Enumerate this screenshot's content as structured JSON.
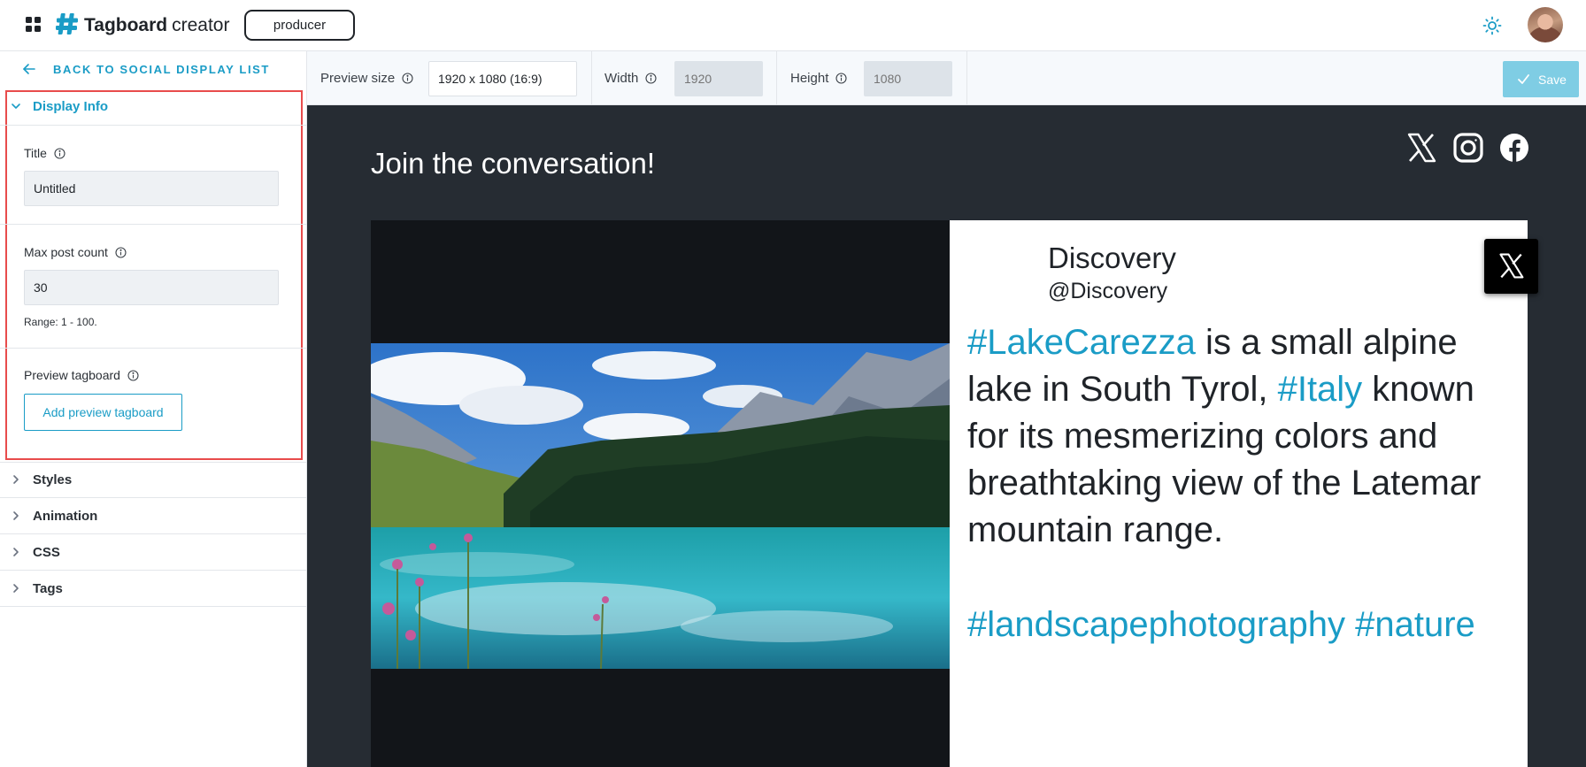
{
  "header": {
    "brand_bold": "Tagboard",
    "brand_light": "creator",
    "role": "producer"
  },
  "sidebar": {
    "back_label": "BACK TO SOCIAL DISPLAY LIST",
    "sections": [
      {
        "label": "Display Info",
        "expanded": true
      },
      {
        "label": "Styles",
        "expanded": false
      },
      {
        "label": "Animation",
        "expanded": false
      },
      {
        "label": "CSS",
        "expanded": false
      },
      {
        "label": "Tags",
        "expanded": false
      }
    ],
    "display_info": {
      "title_label": "Title",
      "title_value": "Untitled",
      "max_post_label": "Max post count",
      "max_post_value": "30",
      "range_hint": "Range: 1 - 100.",
      "preview_label": "Preview tagboard",
      "preview_button": "Add preview tagboard"
    }
  },
  "toolbar": {
    "preview_size_label": "Preview size",
    "preview_size_value": "1920 x 1080 (16:9)",
    "width_label": "Width",
    "width_value": "1920",
    "height_label": "Height",
    "height_value": "1080",
    "save_label": "Save"
  },
  "preview": {
    "headline": "Join the conversation!",
    "social_icons": [
      "x-icon",
      "instagram-icon",
      "facebook-icon"
    ],
    "post": {
      "author_name": "Discovery",
      "author_handle": "@Discovery",
      "body_parts": [
        {
          "text": "#LakeCarezza",
          "tag": true
        },
        {
          "text": " is a small alpine lake in South Tyrol, ",
          "tag": false
        },
        {
          "text": "#Italy",
          "tag": true
        },
        {
          "text": " known for its mesmerizing colors and breathtaking view of the Latemar mountain range.",
          "tag": false
        }
      ],
      "hashtags": "#landscapephotography #nature",
      "network": "x-icon"
    }
  },
  "colors": {
    "accent": "#1a9cc6",
    "highlight": "#e84c4c",
    "canvas": "#262c33",
    "save_disabled": "#7fcde4"
  }
}
